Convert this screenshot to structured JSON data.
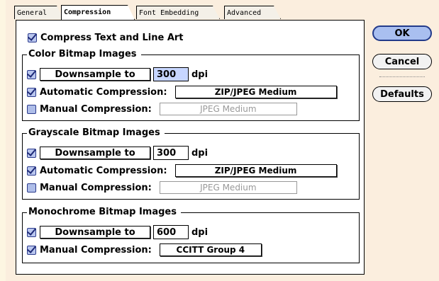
{
  "tabs": [
    "General",
    "Compression",
    "Font Embedding",
    "Advanced"
  ],
  "compress_text": {
    "label": "Compress Text and Line Art",
    "checked": true
  },
  "color": {
    "title": "Color Bitmap Images",
    "downsample_label": "Downsample to",
    "dpi_value": "300",
    "dpi_unit": "dpi",
    "auto_label": "Automatic Compression:",
    "auto_value": "ZIP/JPEG Medium",
    "manual_label": "Manual Compression:",
    "manual_value": "JPEG Medium"
  },
  "gray": {
    "title": "Grayscale Bitmap Images",
    "downsample_label": "Downsample to",
    "dpi_value": "300",
    "dpi_unit": "dpi",
    "auto_label": "Automatic Compression:",
    "auto_value": "ZIP/JPEG Medium",
    "manual_label": "Manual Compression:",
    "manual_value": "JPEG Medium"
  },
  "mono": {
    "title": "Monochrome Bitmap Images",
    "downsample_label": "Downsample to",
    "dpi_value": "600",
    "dpi_unit": "dpi",
    "manual_label": "Manual Compression:",
    "manual_value": "CCITT Group 4"
  },
  "buttons": {
    "ok": "OK",
    "cancel": "Cancel",
    "defaults": "Defaults"
  },
  "colors": {
    "default_button": "#a9bff0",
    "checkbox": "#b9c6ee",
    "background": "#fbeede"
  }
}
